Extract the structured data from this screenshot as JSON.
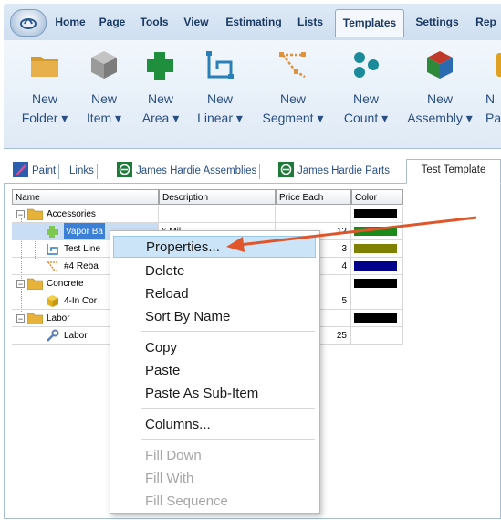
{
  "ribbon_tabs": [
    "Home",
    "Page",
    "Tools",
    "View",
    "Estimating",
    "Lists",
    "Templates",
    "Settings",
    "Rep"
  ],
  "active_tab": "Templates",
  "ribbon_buttons": [
    {
      "line1": "New",
      "line2": "Folder ▾",
      "icon": "folder-icon",
      "color": "#d49a2a"
    },
    {
      "line1": "New",
      "line2": "Item ▾",
      "icon": "cube-icon",
      "color": "#9a9a9a"
    },
    {
      "line1": "New",
      "line2": "Area ▾",
      "icon": "area-icon",
      "color": "#1f8f3e"
    },
    {
      "line1": "New",
      "line2": "Linear ▾",
      "icon": "linear-icon",
      "color": "#2a7fb8"
    },
    {
      "line1": "New",
      "line2": "Segment ▾",
      "icon": "segment-icon",
      "color": "#e0913a"
    },
    {
      "line1": "New",
      "line2": "Count ▾",
      "icon": "count-icon",
      "color": "#1b8a9a"
    },
    {
      "line1": "New",
      "line2": "Assembly ▾",
      "icon": "assembly-icon",
      "color": "#c0392b"
    },
    {
      "line1": "N",
      "line2": "Pa",
      "icon": "partial-icon",
      "color": "#e0a020"
    }
  ],
  "document_tabs": [
    "Paint",
    "Links",
    "James Hardie Assemblies",
    "James Hardie Parts",
    "Test Template"
  ],
  "active_document_tab": "Test Template",
  "grid": {
    "columns": [
      "Name",
      "Description",
      "Price Each",
      "Color"
    ],
    "rows": [
      {
        "name": "Accessories",
        "type": "folder",
        "desc": "",
        "price": "",
        "color": "#000000"
      },
      {
        "name": "Vapor Ba",
        "type": "area",
        "desc": "6 Mil",
        "price": "12",
        "color": "#1b8a1b"
      },
      {
        "name": "Test Line",
        "type": "linear",
        "desc": "",
        "price": "3",
        "color": "#808000"
      },
      {
        "name": "#4 Reba",
        "type": "segment",
        "desc": "",
        "price": "4",
        "color": "#00008b"
      },
      {
        "name": "Concrete",
        "type": "folder",
        "desc": "",
        "price": "",
        "color": "#000000"
      },
      {
        "name": "4-In Cor",
        "type": "cube",
        "desc": "",
        "price": "5",
        "color": ""
      },
      {
        "name": "Labor",
        "type": "folder",
        "desc": "",
        "price": "",
        "color": "#000000"
      },
      {
        "name": "Labor",
        "type": "wrench",
        "desc": "",
        "price": "25",
        "color": ""
      }
    ]
  },
  "context_menu": {
    "groups": [
      [
        {
          "label": "Properties...",
          "highlighted": true
        },
        {
          "label": "Delete"
        },
        {
          "label": "Reload"
        },
        {
          "label": "Sort By Name"
        }
      ],
      [
        {
          "label": "Copy"
        },
        {
          "label": "Paste"
        },
        {
          "label": "Paste As Sub-Item"
        }
      ],
      [
        {
          "label": "Columns..."
        }
      ],
      [
        {
          "label": "Fill Down",
          "disabled": true
        },
        {
          "label": "Fill With",
          "disabled": true
        },
        {
          "label": "Fill Sequence",
          "disabled": true
        }
      ]
    ]
  },
  "annotation_arrow_color": "#e0562a"
}
